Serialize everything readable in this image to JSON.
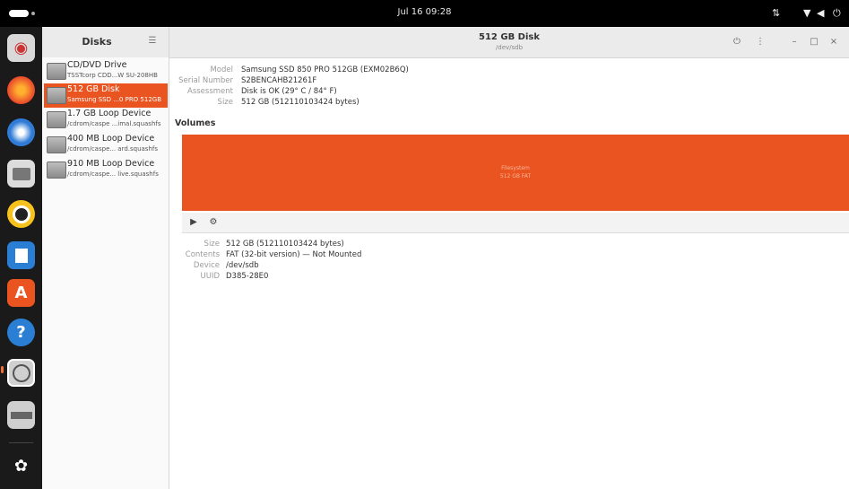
{
  "topbar": {
    "clock": "Jul 16  09:28",
    "tray": [
      "network-icon",
      "wifi-icon",
      "volume-icon",
      "power-icon"
    ]
  },
  "dock": {
    "items": [
      {
        "name": "disks-app-icon"
      },
      {
        "name": "firefox-icon"
      },
      {
        "name": "thunderbird-icon"
      },
      {
        "name": "files-icon"
      },
      {
        "name": "rhythmbox-icon"
      },
      {
        "name": "writer-icon"
      },
      {
        "name": "software-icon"
      },
      {
        "name": "help-icon"
      },
      {
        "name": "disks-running-icon"
      },
      {
        "name": "drive-icon"
      },
      {
        "name": "show-apps-icon"
      }
    ]
  },
  "sidebar": {
    "title": "Disks",
    "drives": [
      {
        "name": "CD/DVD Drive",
        "sub": "TSSTcorp CDD...W SU-208HB",
        "selected": false
      },
      {
        "name": "512 GB Disk",
        "sub": "Samsung SSD ...0 PRO 512GB",
        "selected": true
      },
      {
        "name": "1.7 GB Loop Device",
        "sub": "/cdrom/caspe ...imal.squashfs",
        "selected": false
      },
      {
        "name": "400 MB Loop Device",
        "sub": "/cdrom/caspe... ard.squashfs",
        "selected": false
      },
      {
        "name": "910 MB Loop Device",
        "sub": "/cdrom/caspe... live.squashfs",
        "selected": false
      }
    ]
  },
  "main": {
    "title": "512 GB Disk",
    "subtitle": "/dev/sdb",
    "details": [
      {
        "label": "Model",
        "value": "Samsung SSD 850 PRO 512GB (EXM02B6Q)"
      },
      {
        "label": "Serial Number",
        "value": "S2BENCAHB21261F"
      },
      {
        "label": "Assessment",
        "value": "Disk is OK (29° C / 84° F)"
      },
      {
        "label": "Size",
        "value": "512 GB (512110103424 bytes)"
      }
    ],
    "volumes_label": "Volumes",
    "volume_bar": {
      "line1": "Filesystem",
      "line2": "512 GB FAT"
    },
    "volume_details": [
      {
        "label": "Size",
        "value": "512 GB (512110103424 bytes)"
      },
      {
        "label": "Contents",
        "value": "FAT (32-bit version) — Not Mounted"
      },
      {
        "label": "Device",
        "value": "/dev/sdb"
      },
      {
        "label": "UUID",
        "value": "D385-28E0"
      }
    ]
  },
  "colors": {
    "accent": "#e95420",
    "dock": "#1a1a1a",
    "topbar": "#000000"
  }
}
